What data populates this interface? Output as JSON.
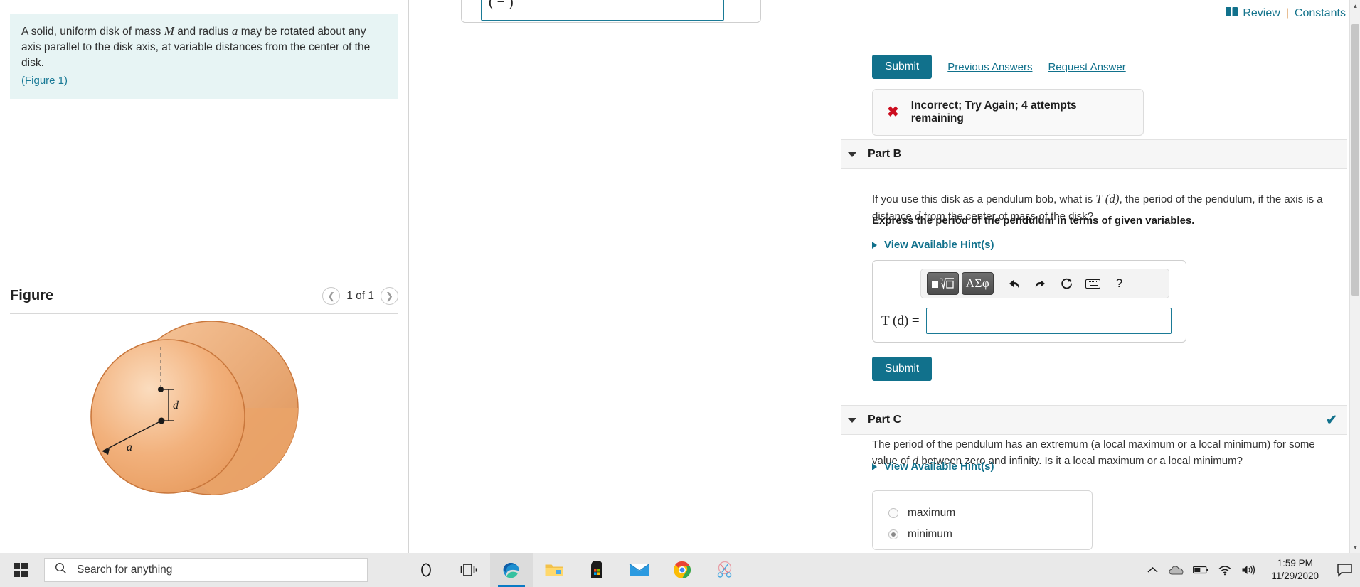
{
  "problem": {
    "text_line1": "A solid, uniform disk of mass ",
    "var_M": "M",
    "text_line1b": " and radius ",
    "var_a": "a",
    "text_line1c": " may be rotated about any axis parallel to the disk axis, at variable distances from the center of the disk.",
    "figure_link": "(Figure 1)"
  },
  "figure": {
    "title": "Figure",
    "counter": "1 of 1",
    "prev_icon": "chevron-left-icon",
    "next_icon": "chevron-right-icon",
    "label_d": "d",
    "label_a": "a"
  },
  "header": {
    "book_icon": "book-icon",
    "review": "Review",
    "separator": "|",
    "constants": "Constants"
  },
  "part_a": {
    "clipped_answer_value": "(  −          )",
    "submit_label": "Submit",
    "previous_answers_label": "Previous Answers",
    "request_answer_label": "Request Answer",
    "feedback_icon": "x-mark-icon",
    "feedback_text": "Incorrect; Try Again; 4 attempts remaining"
  },
  "part_b": {
    "caret_icon": "caret-down-icon",
    "title": "Part B",
    "question_pre": "If you use this disk as a pendulum bob, what is ",
    "question_T": "T (d)",
    "question_mid": ", the period of the pendulum, if the axis is a distance ",
    "question_d": "d",
    "question_post": " from the center of mass of the disk?",
    "instruction": "Express the period of the pendulum in terms of given variables.",
    "hint_label": "View Available Hint(s)",
    "hint_icon": "caret-right-icon",
    "toolbar": {
      "template_button": "template-icon",
      "greek_button": "ΑΣφ",
      "undo_icon": "undo-arrow-icon",
      "redo_icon": "redo-arrow-icon",
      "reset_icon": "reset-circle-icon",
      "keyboard_icon": "keyboard-icon",
      "help_label": "?"
    },
    "answer_label": "T (d) =",
    "answer_value": "",
    "answer_placeholder": "",
    "submit_label": "Submit"
  },
  "part_c": {
    "caret_icon": "caret-down-icon",
    "title": "Part C",
    "status_icon": "check-mark-icon",
    "question_pre": "The period of the pendulum has an extremum (a local maximum or a local minimum) for some value of ",
    "question_d": "d",
    "question_post": " between zero and infinity. Is it a local maximum or a local minimum?",
    "hint_label": "View Available Hint(s)",
    "hint_icon": "caret-right-icon",
    "options": [
      {
        "label": "maximum",
        "selected": false
      },
      {
        "label": "minimum",
        "selected": true
      }
    ]
  },
  "scrollbar": {
    "up_icon": "scroll-up-icon",
    "down_icon": "scroll-down-icon"
  },
  "taskbar": {
    "start_icon": "windows-start-icon",
    "search_icon": "search-icon",
    "search_placeholder": "Search for anything",
    "apps": [
      {
        "name": "cortana-icon",
        "active": false
      },
      {
        "name": "task-view-icon",
        "active": false
      },
      {
        "name": "microsoft-edge-icon",
        "active": true
      },
      {
        "name": "file-explorer-icon",
        "active": false
      },
      {
        "name": "microsoft-store-icon",
        "active": false
      },
      {
        "name": "mail-icon",
        "active": false
      },
      {
        "name": "google-chrome-icon",
        "active": false
      },
      {
        "name": "snip-sketch-icon",
        "active": false
      }
    ],
    "tray": {
      "chevron_icon": "show-hidden-icons-chevron",
      "onedrive_icon": "onedrive-cloud-icon",
      "battery_icon": "battery-icon",
      "wifi_icon": "wifi-icon",
      "volume_icon": "volume-icon",
      "time": "1:59 PM",
      "date": "11/29/2020",
      "notifications_icon": "action-center-icon"
    }
  },
  "colors": {
    "accent_teal": "#11718c",
    "problem_bg": "#e7f4f4",
    "error_red": "#cc0d1f",
    "disk_fill": "#f0a868"
  }
}
